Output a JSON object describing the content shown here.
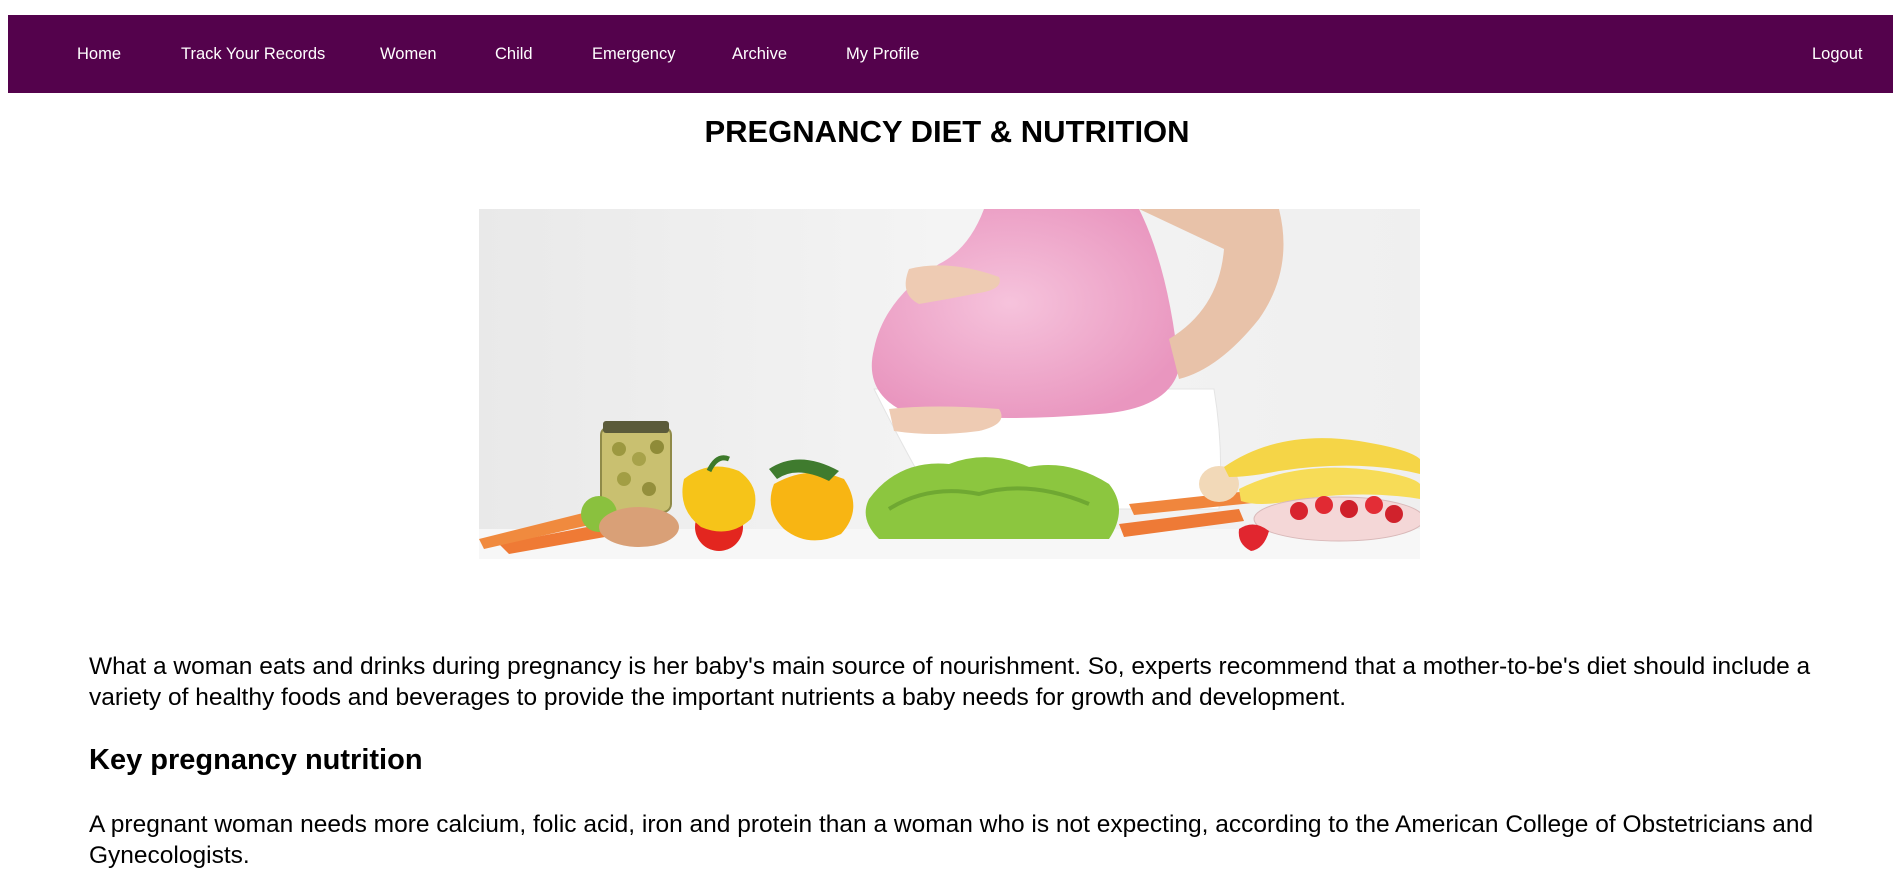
{
  "nav": {
    "items": [
      {
        "label": "Home"
      },
      {
        "label": "Track Your Records"
      },
      {
        "label": "Women"
      },
      {
        "label": "Child"
      },
      {
        "label": "Emergency"
      },
      {
        "label": "Archive"
      },
      {
        "label": "My Profile"
      }
    ],
    "logout_label": "Logout",
    "background_color": "#54024c"
  },
  "page": {
    "title": "PREGNANCY DIET & NUTRITION",
    "hero_image": "pregnant-woman-with-fruits-and-vegetables-photo",
    "intro": "What a woman eats and drinks during pregnancy is her baby's main source of nourishment. So, experts recommend that a mother-to-be's diet should include a variety of healthy foods and beverages to provide the important nutrients a baby needs for growth and development.",
    "section_heading": "Key pregnancy nutrition",
    "section_text": "A pregnant woman needs more calcium, folic acid, iron and protein than a woman who is not expecting, according to the American College of Obstetricians and Gynecologists."
  }
}
